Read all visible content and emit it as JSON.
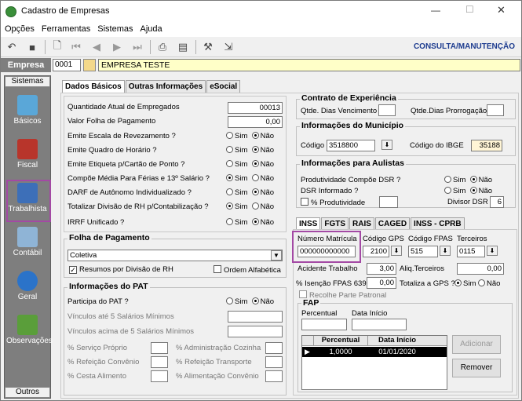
{
  "window": {
    "title": "Cadastro de Empresas",
    "minimize": "—",
    "maximize": "☐",
    "close": "✕"
  },
  "menu": [
    "Opções",
    "Ferramentas",
    "Sistemas",
    "Ajuda"
  ],
  "toolbar": {
    "mode": "CONSULTA/MANUTENÇÃO"
  },
  "empresa": {
    "label": "Empresa",
    "code": "0001",
    "name": "EMPRESA TESTE"
  },
  "sidebar": {
    "header": "Sistemas",
    "footer": "Outros",
    "items": [
      {
        "label": "Básicos",
        "icon": "basicos-icon"
      },
      {
        "label": "Fiscal",
        "icon": "fiscal-icon"
      },
      {
        "label": "Trabalhista",
        "icon": "trabalhista-icon"
      },
      {
        "label": "Contábil",
        "icon": "contabil-icon"
      },
      {
        "label": "Geral",
        "icon": "geral-icon"
      },
      {
        "label": "Observações",
        "icon": "observacoes-icon"
      }
    ]
  },
  "tabs": [
    "Dados Básicos",
    "Outras Informações",
    "eSocial"
  ],
  "basicos": {
    "rows": [
      {
        "label": "Quantidade Atual de Empregados",
        "value": "00013"
      },
      {
        "label": "Valor Folha de Pagamento",
        "value": "0,00"
      },
      {
        "label": "Emite Escala de Revezamento ?"
      },
      {
        "label": "Emite Quadro de Horário ?"
      },
      {
        "label": "Emite Etiqueta p/Cartão de Ponto ?"
      },
      {
        "label": "Compõe Média Para Férias e 13º Salário ?"
      },
      {
        "label": "DARF de Autônomo Individualizado ?"
      },
      {
        "label": "Totalizar Divisão de RH p/Contabilização ?"
      },
      {
        "label": "IRRF Unificado ?"
      }
    ],
    "sim": "Sim",
    "nao": "Não"
  },
  "folha": {
    "title": "Folha de Pagamento",
    "select": "Coletiva",
    "resumos": "Resumos por Divisão de RH",
    "ordem": "Ordem Alfabética"
  },
  "pat": {
    "title": "Informações do PAT",
    "participa": "Participa do PAT ?",
    "vinc5": "Vínculos até 5 Salários Mínimos",
    "vincAcima": "Vínculos acima de 5 Salários Mínimos",
    "servico": "% Serviço Próprio",
    "refeicao": "% Refeição Convênio",
    "cesta": "% Cesta Alimento",
    "adm": "% Administração Cozinha",
    "refTransp": "% Refeição Transporte",
    "aliment": "% Alimentação Convênio"
  },
  "contrato": {
    "title": "Contrato de Experiência",
    "venc": "Qtde. Dias Vencimento",
    "prorr": "Qtde.Dias Prorrogação"
  },
  "municipio": {
    "title": "Informações do Município",
    "codigo_label": "Código",
    "codigo": "3518800",
    "ibge_label": "Código do IBGE",
    "ibge": "35188"
  },
  "aulistas": {
    "title": "Informações para Aulistas",
    "compoe": "Produtividade Compõe DSR ?",
    "dsr": "DSR Informado ?",
    "prod": "% Produtividade",
    "divisor_label": "Divisor DSR",
    "divisor": "6"
  },
  "inss_tabs": [
    "INSS",
    "FGTS",
    "RAIS",
    "CAGED",
    "INSS - CPRB"
  ],
  "inss": {
    "matricula_label": "Número Matrícula",
    "matricula": "000000000000",
    "gps_label": "Código GPS",
    "gps": "2100",
    "fpas_label": "Código FPAS",
    "fpas": "515",
    "terceiros_label": "Terceiros",
    "terceiros": "0115",
    "acidente_label": "Acidente Trabalho",
    "acidente": "3,00",
    "aliq_label": "Aliq.Terceiros",
    "aliq": "0,00",
    "isencao_label": "% Isenção FPAS 639",
    "isencao": "0,00",
    "totaliza": "Totaliza a GPS ?",
    "recolhe": "Recolhe Parte Patronal"
  },
  "fap": {
    "title": "FAP",
    "percentual": "Percentual",
    "data_inicio": "Data Início",
    "cols": [
      "Percentual",
      "Data Início"
    ],
    "rows": [
      {
        "percentual": "1,0000",
        "data": "01/01/2020"
      }
    ],
    "adicionar": "Adicionar",
    "remover": "Remover"
  }
}
